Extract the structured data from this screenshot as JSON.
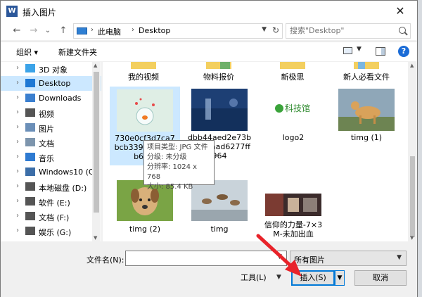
{
  "window": {
    "title": "插入图片",
    "app_icon": "W",
    "close_glyph": "✕"
  },
  "nav": {
    "back_glyph": "←",
    "forward_glyph": "→",
    "history_glyph": "⌄",
    "up_glyph": "↑",
    "breadcrumb": [
      "此电脑",
      "Desktop"
    ],
    "breadcrumb_sep": "›",
    "search_placeholder": "搜索\"Desktop\""
  },
  "toolbar": {
    "organize": "组织 ▾",
    "new_folder": "新建文件夹",
    "help": "?"
  },
  "sidebar": {
    "items": [
      {
        "label": "3D 对象",
        "icon": "3d-objects-icon",
        "color": "#3ba3e8"
      },
      {
        "label": "Desktop",
        "icon": "desktop-icon",
        "color": "#1e78d4"
      },
      {
        "label": "Downloads",
        "icon": "downloads-icon",
        "color": "#3a7fcf"
      },
      {
        "label": "视频",
        "icon": "videos-icon",
        "color": "#555555"
      },
      {
        "label": "图片",
        "icon": "pictures-icon",
        "color": "#6b8fb8"
      },
      {
        "label": "文档",
        "icon": "documents-icon",
        "color": "#7d95ad"
      },
      {
        "label": "音乐",
        "icon": "music-icon",
        "color": "#2e7ad1"
      },
      {
        "label": "Windows10 (C:",
        "icon": "drive-c-icon",
        "color": "#3c6ea8"
      },
      {
        "label": "本地磁盘 (D:)",
        "icon": "drive-icon",
        "color": "#555555"
      },
      {
        "label": "软件 (E:)",
        "icon": "drive-icon",
        "color": "#555555"
      },
      {
        "label": "文档 (F:)",
        "icon": "drive-icon",
        "color": "#555555"
      },
      {
        "label": "娱乐 (G:)",
        "icon": "drive-icon",
        "color": "#555555"
      }
    ]
  },
  "files": {
    "top_row": [
      "我的视频",
      "物料报价",
      "新极思",
      "新人必看文件"
    ],
    "row1": [
      {
        "name": "730e0cf3d7ca7bcb339fb8b096b63f6",
        "kind": "goldfish-image"
      },
      {
        "name": "dbb44aed2e73b398f7aad6277ff964",
        "kind": "blue-image"
      },
      {
        "name": "logo2",
        "kind": "logo-image",
        "logo_text": "科技馆"
      },
      {
        "name": "timg (1)",
        "kind": "dog-image"
      }
    ],
    "row2": [
      {
        "name": "timg (2)",
        "kind": "puppy-image"
      },
      {
        "name": "timg",
        "kind": "birds-image"
      },
      {
        "name": "信仰的力量-7×3M-未加出血",
        "kind": "banner-image"
      }
    ]
  },
  "tooltip": {
    "lines": [
      "项目类型: JPG 文件",
      "分级: 未分级",
      "分辨率: 1024 x 768",
      "大小: 85.4 KB"
    ]
  },
  "bottom": {
    "filename_label": "文件名(N):",
    "filename_value": "",
    "filter_value": "所有图片",
    "tools_label": "工具(L)",
    "insert_label": "插入(S)",
    "cancel_label": "取消",
    "dropdown_glyph": "▼"
  },
  "colors": {
    "selection": "#cce8ff",
    "accent": "#0078d7",
    "arrow": "#e8232a"
  }
}
